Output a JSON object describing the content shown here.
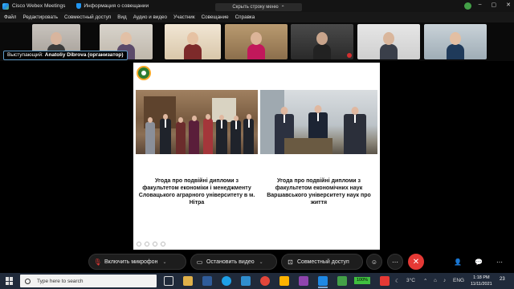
{
  "titlebar": {
    "app_title": "Cisco Webex Meetings",
    "meeting_info": "Информация о совещании"
  },
  "menu": {
    "items": [
      "Файл",
      "Редактировать",
      "Совместный доступ",
      "Вид",
      "Аудио и видео",
      "Участник",
      "Совещание",
      "Справка"
    ],
    "hide_bar": "Скрыть строку меню"
  },
  "speaker": {
    "prefix": "Выступающий: ",
    "name": "Anatoliy Dibrova (организатор)"
  },
  "slide": {
    "caption_left": "Угода про подвійні дипломи з факультетом економіки і менеджменту Словацького аграрного університету в м. Нітра",
    "caption_right": "Угода про подвійні дипломи з факультетом економічних наук Варшавського університету наук про життя"
  },
  "controls": {
    "mic": "Включить микрофон",
    "video": "Остановить видео",
    "share": "Совместный доступ"
  },
  "taskbar": {
    "search_placeholder": "Type here to search",
    "battery": "100%",
    "weather": "3°C",
    "lang": "ENG",
    "time": "1:18 PM",
    "date": "11/11/2021",
    "notifications": "23"
  },
  "colors": {
    "end_call": "#e53935",
    "accent": "#1e88e5",
    "taskbar": "#202a3a"
  }
}
